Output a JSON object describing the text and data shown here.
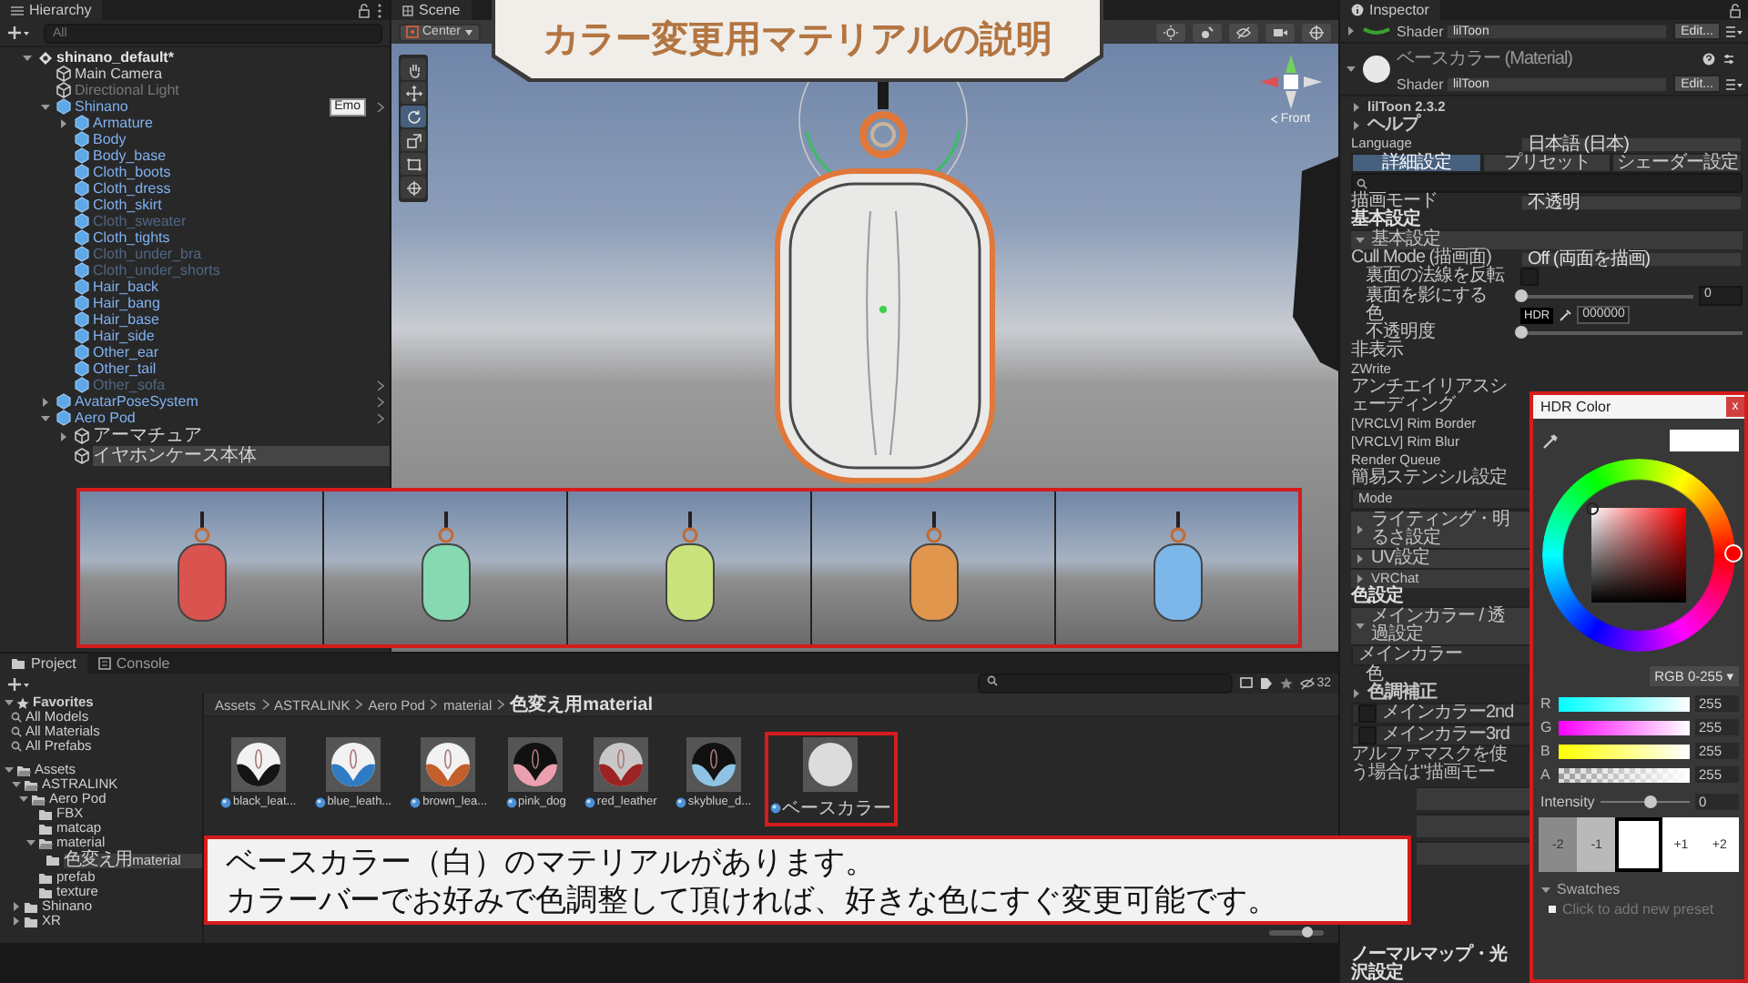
{
  "title_banner": "カラー変更用マテリアルの説明",
  "hierarchy": {
    "tab": "Hierarchy",
    "search_placeholder": "All",
    "items": [
      {
        "label": "shinano_default*",
        "kind": "scene",
        "expanded": true,
        "selected": false,
        "disabled": false,
        "chevron": false,
        "children": [
          {
            "label": "Main Camera",
            "kind": "object",
            "selected": false,
            "disabled": false,
            "chevron": false
          },
          {
            "label": "Directional Light",
            "kind": "object",
            "selected": false,
            "disabled": true,
            "chevron": false
          },
          {
            "label": "Shinano",
            "kind": "prefab",
            "expanded": true,
            "selected": false,
            "disabled": false,
            "chevron": true,
            "badge": "Emo",
            "children": [
              {
                "label": "Armature",
                "kind": "prefab",
                "expanded": false,
                "selected": false,
                "disabled": false,
                "chevron": false
              },
              {
                "label": "Body",
                "kind": "prefab",
                "selected": false,
                "disabled": false,
                "chevron": false
              },
              {
                "label": "Body_base",
                "kind": "prefab",
                "selected": false,
                "disabled": false,
                "chevron": false
              },
              {
                "label": "Cloth_boots",
                "kind": "prefab",
                "selected": false,
                "disabled": false,
                "chevron": false
              },
              {
                "label": "Cloth_dress",
                "kind": "prefab",
                "selected": false,
                "disabled": false,
                "chevron": false
              },
              {
                "label": "Cloth_skirt",
                "kind": "prefab",
                "selected": false,
                "disabled": false,
                "chevron": false
              },
              {
                "label": "Cloth_sweater",
                "kind": "prefab",
                "selected": false,
                "disabled": true,
                "chevron": false
              },
              {
                "label": "Cloth_tights",
                "kind": "prefab",
                "selected": false,
                "disabled": false,
                "chevron": false
              },
              {
                "label": "Cloth_under_bra",
                "kind": "prefab",
                "selected": false,
                "disabled": true,
                "chevron": false
              },
              {
                "label": "Cloth_under_shorts",
                "kind": "prefab",
                "selected": false,
                "disabled": true,
                "chevron": false
              },
              {
                "label": "Hair_back",
                "kind": "prefab",
                "selected": false,
                "disabled": false,
                "chevron": false
              },
              {
                "label": "Hair_bang",
                "kind": "prefab",
                "selected": false,
                "disabled": false,
                "chevron": false
              },
              {
                "label": "Hair_base",
                "kind": "prefab",
                "selected": false,
                "disabled": false,
                "chevron": false
              },
              {
                "label": "Hair_side",
                "kind": "prefab",
                "selected": false,
                "disabled": false,
                "chevron": false
              },
              {
                "label": "Other_ear",
                "kind": "prefab",
                "selected": false,
                "disabled": false,
                "chevron": false
              },
              {
                "label": "Other_tail",
                "kind": "prefab",
                "selected": false,
                "disabled": false,
                "chevron": false
              },
              {
                "label": "Other_sofa",
                "kind": "prefab",
                "selected": false,
                "disabled": true,
                "chevron": true
              }
            ]
          },
          {
            "label": "AvatarPoseSystem",
            "kind": "prefab",
            "expanded": false,
            "selected": false,
            "disabled": false,
            "chevron": true
          },
          {
            "label": "Aero Pod",
            "kind": "prefab",
            "expanded": true,
            "selected": false,
            "disabled": false,
            "chevron": true,
            "children": [
              {
                "label": "アーマチュア",
                "kind": "object",
                "expanded": false,
                "selected": false,
                "disabled": false,
                "chevron": false
              },
              {
                "label": "イヤホンケース本体",
                "kind": "object",
                "selected": true,
                "disabled": false,
                "chevron": false
              }
            ]
          }
        ]
      }
    ]
  },
  "scene": {
    "tab": "Scene",
    "pivot": "Center",
    "view_label": "Front",
    "tools": [
      {
        "kind": "hand",
        "selected": false
      },
      {
        "kind": "move",
        "selected": false
      },
      {
        "kind": "rotate",
        "selected": true
      },
      {
        "kind": "scale",
        "selected": false
      },
      {
        "kind": "rect",
        "selected": false
      },
      {
        "kind": "transform",
        "selected": false
      }
    ]
  },
  "previews": [
    {
      "color": "#d9534f"
    },
    {
      "color": "#86d9b0"
    },
    {
      "color": "#c9e27c"
    },
    {
      "color": "#e0964c"
    },
    {
      "color": "#7db6e8"
    }
  ],
  "project": {
    "tabs": [
      {
        "label": "Project",
        "selected": true
      },
      {
        "label": "Console",
        "selected": false
      }
    ],
    "count": "32",
    "favorites": {
      "label": "Favorites",
      "expanded": true,
      "items": [
        {
          "label": "All Models",
          "selected": false
        },
        {
          "label": "All Materials",
          "selected": false
        },
        {
          "label": "All Prefabs",
          "selected": false
        }
      ]
    },
    "folders": [
      {
        "label": "Assets",
        "expanded": true,
        "selected": false,
        "children": [
          {
            "label": "ASTRALINK",
            "expanded": true,
            "selected": false,
            "children": [
              {
                "label": "Aero Pod",
                "expanded": true,
                "selected": false,
                "children": [
                  {
                    "label": "FBX",
                    "selected": false
                  },
                  {
                    "label": "matcap",
                    "selected": false
                  },
                  {
                    "label": "material",
                    "expanded": true,
                    "selected": false,
                    "children": [
                      {
                        "label": "色変え用material",
                        "selected": true
                      }
                    ]
                  },
                  {
                    "label": "prefab",
                    "selected": false
                  },
                  {
                    "label": "texture",
                    "selected": false
                  }
                ]
              }
            ]
          },
          {
            "label": "Shinano",
            "expanded": false,
            "selected": false
          },
          {
            "label": "XR",
            "expanded": false,
            "selected": false
          }
        ]
      }
    ],
    "breadcrumb": [
      "Assets",
      "ASTRALINK",
      "Aero Pod",
      "material",
      "色変え用material"
    ],
    "assets": [
      {
        "name": "black_leat...",
        "kind": "lighttop",
        "color": "#151515",
        "highlighted": false
      },
      {
        "name": "blue_leath...",
        "kind": "lighttop",
        "color": "#2f7cc4",
        "highlighted": false
      },
      {
        "name": "brown_lea...",
        "kind": "lighttop",
        "color": "#c25f2a",
        "highlighted": false
      },
      {
        "name": "pink_dog",
        "kind": "darktop",
        "color": "#eaa0b0",
        "highlighted": false
      },
      {
        "name": "red_leather",
        "kind": "greytop",
        "color": "#9b2323",
        "highlighted": false
      },
      {
        "name": "skyblue_d...",
        "kind": "darktop",
        "color": "#8fc3e3",
        "highlighted": false
      },
      {
        "name": "ベースカラー",
        "kind": "plain",
        "color": "#dcdcdc",
        "highlighted": true
      }
    ],
    "zoom_slider": {
      "level": 0.7
    }
  },
  "caption": [
    "ベースカラー（白）のマテリアルがあります。",
    "カラーバーでお好みで色調整して頂ければ、好きな色にすぐ変更可能です。"
  ],
  "inspector": {
    "tab": "Inspector",
    "materials": [
      {
        "shader_label": "Shader",
        "shader": "lilToon",
        "edit": "Edit...",
        "expanded": false
      },
      {
        "name": "ベースカラー (Material)",
        "shader_label": "Shader",
        "shader": "lilToon",
        "edit": "Edit...",
        "expanded": true
      }
    ],
    "rows": [
      {
        "kind": "foldout",
        "label": "lilToon 2.3.2",
        "expanded": false
      },
      {
        "kind": "foldout",
        "label": "ヘルプ",
        "expanded": false
      },
      {
        "kind": "dropdown",
        "label": "Language",
        "value": "日本語 (日本)"
      },
      {
        "kind": "tabs",
        "tabs": [
          {
            "label": "詳細設定",
            "selected": true
          },
          {
            "label": "プリセット",
            "selected": false
          },
          {
            "label": "シェーダー設定",
            "selected": false
          }
        ]
      },
      {
        "kind": "search"
      },
      {
        "kind": "dropdown",
        "label": "描画モード",
        "value": "不透明"
      },
      {
        "kind": "heading",
        "label": "基本設定"
      },
      {
        "kind": "section",
        "label": "基本設定",
        "expanded": true
      },
      {
        "kind": "dropdown",
        "label": "Cull Mode (描画面)",
        "value": "Off (両面を描画)",
        "children": [
          {
            "kind": "checkbox",
            "label": "裏面の法線を反転",
            "checked": false
          },
          {
            "kind": "slider",
            "label": "裏面を影にする",
            "level": 0,
            "reading": "0"
          },
          {
            "kind": "color",
            "label": "色",
            "hdr": "HDR",
            "value": "000000"
          },
          {
            "kind": "slider",
            "label": "不透明度",
            "level": 0
          }
        ]
      },
      {
        "kind": "label",
        "label": "非表示"
      },
      {
        "kind": "label",
        "label": "ZWrite"
      },
      {
        "kind": "label",
        "label": "アンチエイリアスシェーディング"
      },
      {
        "kind": "label",
        "label": "[VRCLV] Rim Border"
      },
      {
        "kind": "label",
        "label": "[VRCLV] Rim Blur"
      },
      {
        "kind": "label",
        "label": "Render Queue"
      },
      {
        "kind": "subheading",
        "label": "簡易ステンシル設定"
      },
      {
        "kind": "boxed",
        "label": "Mode"
      },
      {
        "kind": "section",
        "label": "ライティング・明るさ設定",
        "expanded": false
      },
      {
        "kind": "section",
        "label": "UV設定",
        "expanded": false
      },
      {
        "kind": "section",
        "label": "VRChat",
        "expanded": false
      },
      {
        "kind": "heading",
        "label": "色設定"
      },
      {
        "kind": "section",
        "label": "メインカラー / 透過設定",
        "expanded": true
      },
      {
        "kind": "boxed",
        "label": "メインカラー",
        "children": [
          {
            "kind": "swatch",
            "label": "色"
          },
          {
            "kind": "foldout",
            "label": "色調補正",
            "expanded": false
          }
        ]
      },
      {
        "kind": "toggle",
        "label": "メインカラー2nd",
        "checked": false
      },
      {
        "kind": "toggle",
        "label": "メインカラー3rd",
        "checked": false
      },
      {
        "kind": "note",
        "label": "アルファマスクを使う場合は\"描画モー"
      },
      {
        "kind": "bar"
      },
      {
        "kind": "bar"
      },
      {
        "kind": "bar"
      },
      {
        "kind": "bottomheading",
        "label": "ノーマルマップ・光沢設定"
      }
    ]
  },
  "hdr_color": {
    "title": "HDR Color",
    "close": "x",
    "mode": "RGB 0-255 ▾",
    "channels": [
      {
        "name": "R",
        "value": "255",
        "level": 1
      },
      {
        "name": "G",
        "value": "255",
        "level": 1
      },
      {
        "name": "B",
        "value": "255",
        "level": 1
      },
      {
        "name": "A",
        "value": "255",
        "level": 1
      }
    ],
    "intensity": {
      "label": "Intensity",
      "level": 0.55,
      "reading": "0"
    },
    "exposure": [
      {
        "label": "-2",
        "color": "#8a8a8a",
        "selected": false
      },
      {
        "label": "-1",
        "color": "#b9b9b9",
        "selected": false
      },
      {
        "color": "#ffffff",
        "selected": true
      },
      {
        "label": "+1",
        "color": "#ffffff",
        "selected": false
      },
      {
        "label": "+2",
        "color": "#ffffff",
        "selected": false
      }
    ],
    "swatches": {
      "label": "Swatches",
      "expanded": true,
      "hint": "Click to add new preset"
    }
  }
}
